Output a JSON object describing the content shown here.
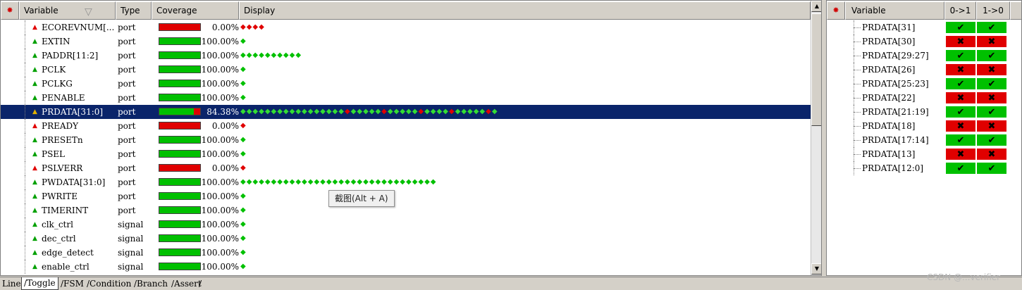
{
  "left_pane": {
    "headers": {
      "variable": "Variable",
      "type": "Type",
      "coverage": "Coverage",
      "display": "Display"
    },
    "rows": [
      {
        "name": "ECOREVNUM[...",
        "type": "port",
        "coverage": 0.0,
        "pct": "0.00%",
        "status": "red",
        "toggles": "rrrr"
      },
      {
        "name": "EXTIN",
        "type": "port",
        "coverage": 1.0,
        "pct": "100.00%",
        "status": "green",
        "toggles": "g"
      },
      {
        "name": "PADDR[11:2]",
        "type": "port",
        "coverage": 1.0,
        "pct": "100.00%",
        "status": "green",
        "toggles": "gggggggggg"
      },
      {
        "name": "PCLK",
        "type": "port",
        "coverage": 1.0,
        "pct": "100.00%",
        "status": "green",
        "toggles": "g"
      },
      {
        "name": "PCLKG",
        "type": "port",
        "coverage": 1.0,
        "pct": "100.00%",
        "status": "green",
        "toggles": "g"
      },
      {
        "name": "PENABLE",
        "type": "port",
        "coverage": 1.0,
        "pct": "100.00%",
        "status": "green",
        "toggles": "g"
      },
      {
        "name": "PRDATA[31:0]",
        "type": "port",
        "coverage": 0.8438,
        "pct": "84.38%",
        "status": "warn",
        "selected": true,
        "toggles": "gggggggggggggggggrgggggrgggggrggggrgggggrg"
      },
      {
        "name": "PREADY",
        "type": "port",
        "coverage": 0.0,
        "pct": "0.00%",
        "status": "red",
        "toggles": "r"
      },
      {
        "name": "PRESETn",
        "type": "port",
        "coverage": 1.0,
        "pct": "100.00%",
        "status": "green",
        "toggles": "g"
      },
      {
        "name": "PSEL",
        "type": "port",
        "coverage": 1.0,
        "pct": "100.00%",
        "status": "green",
        "toggles": "g"
      },
      {
        "name": "PSLVERR",
        "type": "port",
        "coverage": 0.0,
        "pct": "0.00%",
        "status": "red",
        "toggles": "r"
      },
      {
        "name": "PWDATA[31:0]",
        "type": "port",
        "coverage": 1.0,
        "pct": "100.00%",
        "status": "green",
        "toggles": "gggggggggggggggggggggggggggggggg"
      },
      {
        "name": "PWRITE",
        "type": "port",
        "coverage": 1.0,
        "pct": "100.00%",
        "status": "green",
        "toggles": "g"
      },
      {
        "name": "TIMERINT",
        "type": "port",
        "coverage": 1.0,
        "pct": "100.00%",
        "status": "green",
        "toggles": "g"
      },
      {
        "name": "clk_ctrl",
        "type": "signal",
        "coverage": 1.0,
        "pct": "100.00%",
        "status": "green",
        "toggles": "g"
      },
      {
        "name": "dec_ctrl",
        "type": "signal",
        "coverage": 1.0,
        "pct": "100.00%",
        "status": "green",
        "toggles": "g"
      },
      {
        "name": "edge_detect",
        "type": "signal",
        "coverage": 1.0,
        "pct": "100.00%",
        "status": "green",
        "toggles": "g"
      },
      {
        "name": "enable_ctrl",
        "type": "signal",
        "coverage": 1.0,
        "pct": "100.00%",
        "status": "green",
        "toggles": "g"
      }
    ]
  },
  "tooltip": "截图(Alt + A)",
  "right_pane": {
    "headers": {
      "variable": "Variable",
      "rise": "0->1",
      "fall": "1->0"
    },
    "rows": [
      {
        "name": "PRDATA[31]",
        "rise": true,
        "fall": true
      },
      {
        "name": "PRDATA[30]",
        "rise": false,
        "fall": false
      },
      {
        "name": "PRDATA[29:27]",
        "rise": true,
        "fall": true
      },
      {
        "name": "PRDATA[26]",
        "rise": false,
        "fall": false
      },
      {
        "name": "PRDATA[25:23]",
        "rise": true,
        "fall": true
      },
      {
        "name": "PRDATA[22]",
        "rise": false,
        "fall": false
      },
      {
        "name": "PRDATA[21:19]",
        "rise": true,
        "fall": true
      },
      {
        "name": "PRDATA[18]",
        "rise": false,
        "fall": false
      },
      {
        "name": "PRDATA[17:14]",
        "rise": true,
        "fall": true
      },
      {
        "name": "PRDATA[13]",
        "rise": false,
        "fall": false
      },
      {
        "name": "PRDATA[12:0]",
        "rise": true,
        "fall": true
      }
    ],
    "check_glyph": "✔",
    "cross_glyph": "✖"
  },
  "tabs": [
    {
      "label": "Line",
      "active": false
    },
    {
      "label": "Toggle",
      "active": true
    },
    {
      "label": "FSM",
      "active": false
    },
    {
      "label": "Condition",
      "active": false
    },
    {
      "label": "Branch",
      "active": false
    },
    {
      "label": "Assert",
      "active": false
    }
  ],
  "watermark": "CSDN @...verifier",
  "colors": {
    "selection": "#0a246a",
    "covered": "#00c000",
    "uncovered": "#e00000",
    "warning": "#e0b000"
  },
  "icons": {
    "bug": "bug-icon",
    "sort": "sort-descending-icon",
    "triangle": "status-triangle-icon",
    "toggle_diamond": "toggle-diamond-icon"
  }
}
